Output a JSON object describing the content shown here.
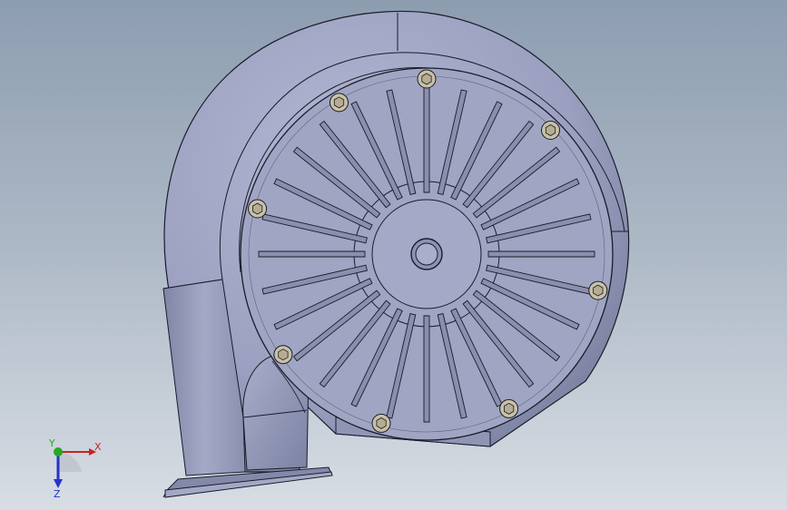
{
  "viewport": {
    "model": "centrifugal-blower-housing",
    "colors": {
      "background_top": "#8d9db0",
      "background_bottom": "#d8dde4",
      "body": "#9ea3c2",
      "body_dark": "#7e84a6",
      "edge": "#1a1c2a",
      "bolt": "#c9c1a6"
    }
  },
  "triad": {
    "x_label": "X",
    "y_label": "Y",
    "z_label": "Z",
    "colors": {
      "x": "#cc2222",
      "y": "#22aa22",
      "z": "#2233cc"
    }
  }
}
